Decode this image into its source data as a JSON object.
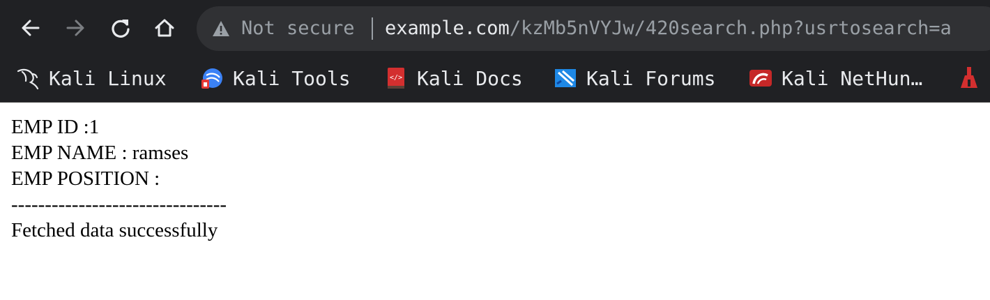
{
  "browser": {
    "security_label": "Not secure",
    "url_host": "example.com",
    "url_path": "/kzMb5nVYJw/420search.php?usrtosearch=a",
    "icons": {
      "back": "back-arrow-icon",
      "forward": "forward-arrow-icon",
      "reload": "reload-icon",
      "home": "home-icon",
      "warning": "warning-triangle-icon"
    }
  },
  "bookmarks": [
    {
      "label": "Kali Linux",
      "icon": "kali-dragon-icon"
    },
    {
      "label": "Kali Tools",
      "icon": "kali-tools-icon"
    },
    {
      "label": "Kali Docs",
      "icon": "kali-docs-icon"
    },
    {
      "label": "Kali Forums",
      "icon": "kali-forums-icon"
    },
    {
      "label": "Kali NetHun…",
      "icon": "kali-nethunter-icon"
    }
  ],
  "page": {
    "lines": [
      "EMP ID :1",
      "EMP NAME : ramses",
      "EMP POSITION :",
      "--------------------------------",
      "Fetched data successfully"
    ]
  }
}
